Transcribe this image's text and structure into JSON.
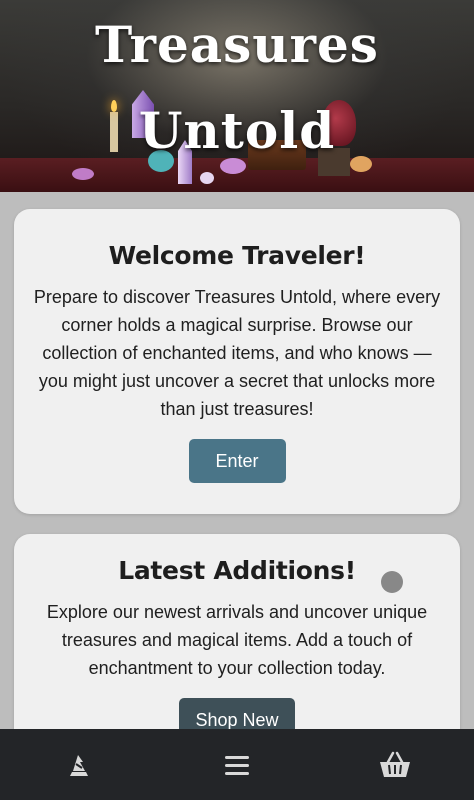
{
  "hero": {
    "title_line1": "Treasures",
    "title_line2": "Untold"
  },
  "welcome_card": {
    "heading": "Welcome Traveler!",
    "body": "Prepare to discover Treasures Untold, where every corner holds a magical surprise. Browse our collection of enchanted items, and who knows — you might just uncover a secret that unlocks more than just treasures!",
    "button_label": "Enter"
  },
  "latest_card": {
    "heading": "Latest Additions!",
    "body": "Explore our newest arrivals and uncover unique treasures and magical items. Add a touch of enchantment to your collection today.",
    "button_label": "Shop New"
  },
  "bottom_nav": {
    "items": [
      {
        "icon": "wizard-hat-icon"
      },
      {
        "icon": "menu-icon"
      },
      {
        "icon": "basket-icon"
      }
    ]
  },
  "colors": {
    "button_primary": "#4a7588",
    "nav_background": "#232528",
    "card_background": "#f0f0f0"
  }
}
